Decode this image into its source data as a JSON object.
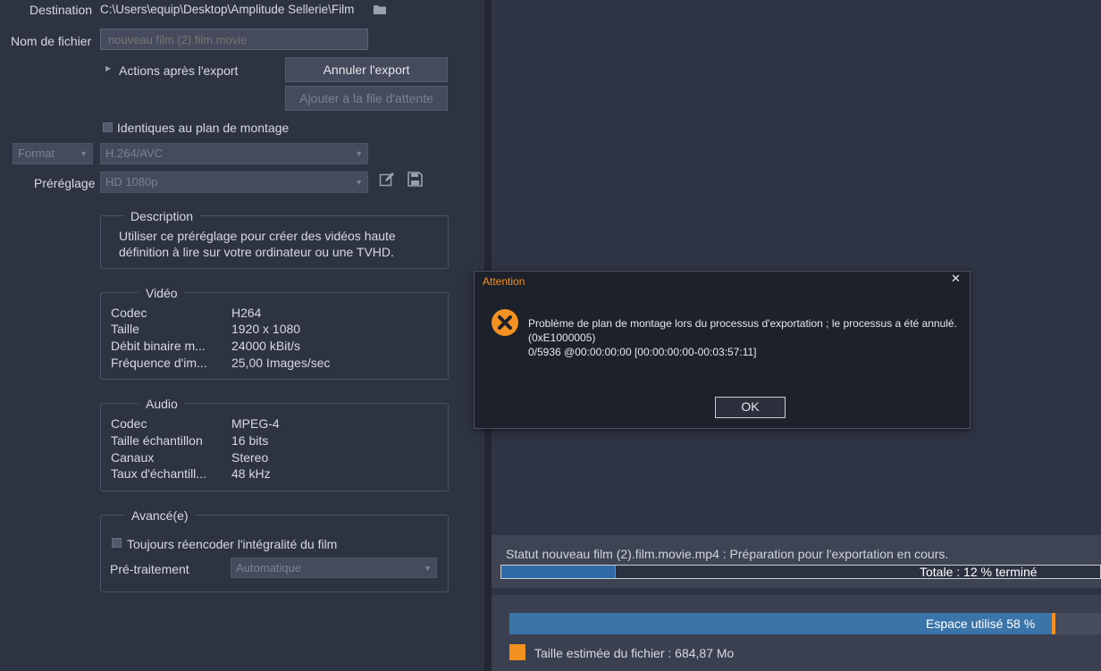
{
  "destination": {
    "label": "Destination",
    "path": "C:\\Users\\equip\\Desktop\\Amplitude Sellerie\\Film",
    "icon": "folder-icon"
  },
  "filename": {
    "label": "Nom de fichier",
    "placeholder": "nouveau film (2).film.movie"
  },
  "actions_after_export": {
    "label": "Actions après l'export"
  },
  "buttons": {
    "cancel_export": "Annuler l'export",
    "add_to_queue": "Ajouter à la file d'attente"
  },
  "identical_to_timeline": {
    "label": "Identiques au plan de montage",
    "checked": false
  },
  "format": {
    "label": "Format",
    "value": "H.264/AVC"
  },
  "preset": {
    "label": "Préréglage",
    "value": "HD 1080p",
    "edit_icon": "edit-icon",
    "save_icon": "save-icon"
  },
  "description": {
    "legend": "Description",
    "line1": "Utiliser ce préréglage pour créer des vidéos haute",
    "line2": "définition à lire sur votre ordinateur ou une TVHD."
  },
  "video": {
    "legend": "Vidéo",
    "rows": [
      {
        "key": "Codec",
        "value": "H264"
      },
      {
        "key": "Taille",
        "value": "1920 x 1080"
      },
      {
        "key": "Débit binaire m...",
        "value": "24000 kBit/s"
      },
      {
        "key": "Fréquence d'im...",
        "value": "25,00 Images/sec"
      }
    ]
  },
  "audio": {
    "legend": "Audio",
    "rows": [
      {
        "key": "Codec",
        "value": "MPEG-4"
      },
      {
        "key": "Taille échantillon",
        "value": "16 bits"
      },
      {
        "key": "Canaux",
        "value": "Stereo"
      },
      {
        "key": "Taux d'échantill...",
        "value": "48 kHz"
      }
    ]
  },
  "advanced": {
    "legend": "Avancé(e)",
    "reencode_label": "Toujours réencoder l'intégralité du film",
    "reencode_checked": false,
    "preprocess_label": "Pré-traitement",
    "preprocess_value": "Automatique"
  },
  "dialog": {
    "title": "Attention",
    "close": "✕",
    "icon": "error-icon",
    "line1": "Problème de plan de montage lors du processus d'exportation ; le processus a été annulé.",
    "line2": "(0xE1000005)",
    "line3": "0/5936 @00:00:00:00  [00:00:00:00-00:03:57:11]",
    "ok": "OK"
  },
  "status": {
    "text": "Statut nouveau film (2).film.movie.mp4 : Préparation pour l'exportation en cours.",
    "progress_label": "Totale : 12 % terminé",
    "progress_fraction": 0.19
  },
  "space": {
    "label": "Espace utilisé 58 %",
    "estimated_size": "Taille estimée du fichier : 684,87 Mo"
  },
  "colors": {
    "accent_orange": "#f39121",
    "progress_blue": "#3a78b8",
    "space_blue": "#3b74a8"
  }
}
